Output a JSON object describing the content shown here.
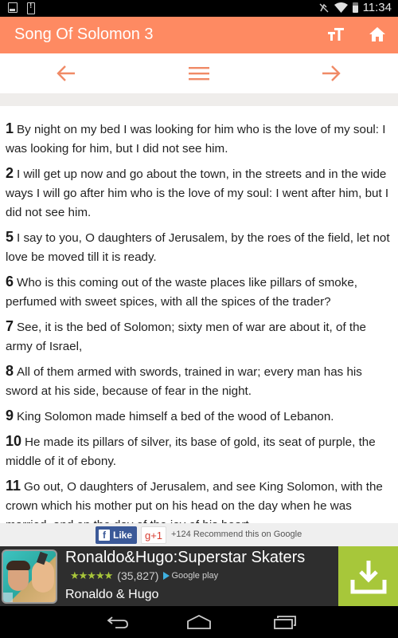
{
  "status_bar": {
    "time": "11:34",
    "left_icons": [
      "image-notification-icon",
      "alert-notification-icon"
    ],
    "right_icons": [
      "mute-icon",
      "wifi-icon",
      "battery-icon"
    ]
  },
  "app_bar": {
    "title": "Song Of Solomon 3",
    "actions": [
      "text-size-icon",
      "home-icon"
    ],
    "color": "#fe8a62"
  },
  "nav_bar": {
    "buttons": [
      "previous-chapter",
      "chapter-menu",
      "next-chapter"
    ],
    "icon_color": "#f08a66"
  },
  "verses": [
    {
      "num": "1",
      "text": "By night on my bed I was looking for him who is the love of my soul: I was looking for him, but I did not see him."
    },
    {
      "num": "2",
      "text": "I will get up now and go about the town, in the streets and in the wide ways I will go after him who is the love of my soul: I went after him, but I did not see him."
    },
    {
      "num": "5",
      "text": "I say to you, O daughters of Jerusalem, by the roes of the field, let not love be moved till it is ready."
    },
    {
      "num": "6",
      "text": "Who is this coming out of the waste places like pillars of smoke, perfumed with sweet spices, with all the spices of the trader?"
    },
    {
      "num": "7",
      "text": "See, it is the bed of Solomon; sixty men of war are about it, of the army of Israel,"
    },
    {
      "num": "8",
      "text": "All of them armed with swords, trained in war; every man has his sword at his side, because of fear in the night."
    },
    {
      "num": "9",
      "text": "King Solomon made himself a bed of the wood of Lebanon."
    },
    {
      "num": "10",
      "text": "He made its pillars of silver, its base of gold, its seat of purple, the middle of it of ebony."
    },
    {
      "num": "11",
      "text": "Go out, O daughters of Jerusalem, and see King Solomon, with the crown which his mother put on his head on the day when he was married, and on the day of the joy of his heart."
    }
  ],
  "social": {
    "fb_like_label": "Like",
    "fb_letter": "f",
    "gplus_label": "g+1",
    "recommend_text": "+124 Recommend this on Google"
  },
  "ad": {
    "title": "Ronaldo&Hugo:Superstar Skaters",
    "stars": "★★★★★",
    "rating_count": "(35,827)",
    "store_label": "Google play",
    "developer": "Ronaldo & Hugo",
    "download_color": "#a7c73a"
  },
  "system_nav": {
    "buttons": [
      "back",
      "home",
      "recent-apps"
    ]
  }
}
